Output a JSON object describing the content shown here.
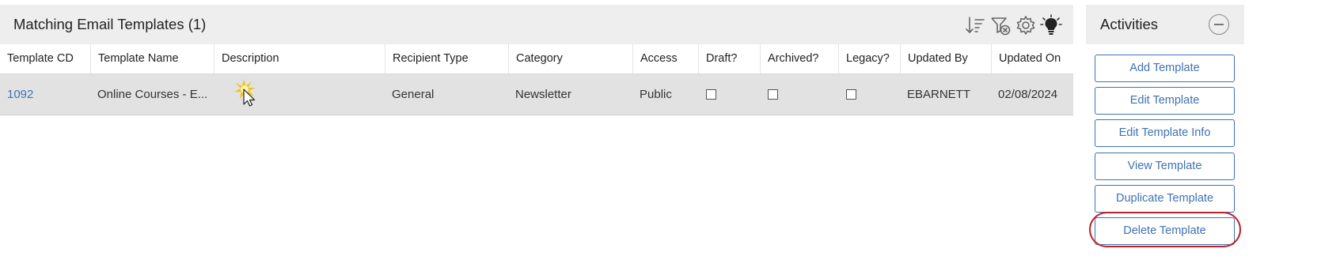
{
  "main": {
    "title": "Matching Email Templates (1)",
    "toolbar_icons": [
      "sort-icon",
      "filter-clear-icon",
      "settings-gear-icon",
      "lightbulb-icon"
    ]
  },
  "columns": [
    "Template CD",
    "Template Name",
    "Description",
    "Recipient Type",
    "Category",
    "Access",
    "Draft?",
    "Archived?",
    "Legacy?",
    "Updated By",
    "Updated On"
  ],
  "rows": [
    {
      "template_cd": "1092",
      "template_name": "Online Courses - E...",
      "description": "",
      "recipient_type": "General",
      "category": "Newsletter",
      "access": "Public",
      "draft": false,
      "archived": false,
      "legacy": false,
      "updated_by": "EBARNETT",
      "updated_on": "02/08/2024"
    }
  ],
  "activities": {
    "title": "Activities",
    "buttons": [
      "Add Template",
      "Edit Template",
      "Edit Template Info",
      "View Template",
      "Duplicate Template",
      "Delete Template"
    ],
    "highlighted": "Delete Template"
  },
  "colors": {
    "link": "#3f72b3",
    "header_bg": "#eeeeee",
    "row_bg": "#e2e2e2",
    "highlight_ring": "#c0222a",
    "cursor_glow": "#f2c21b"
  }
}
